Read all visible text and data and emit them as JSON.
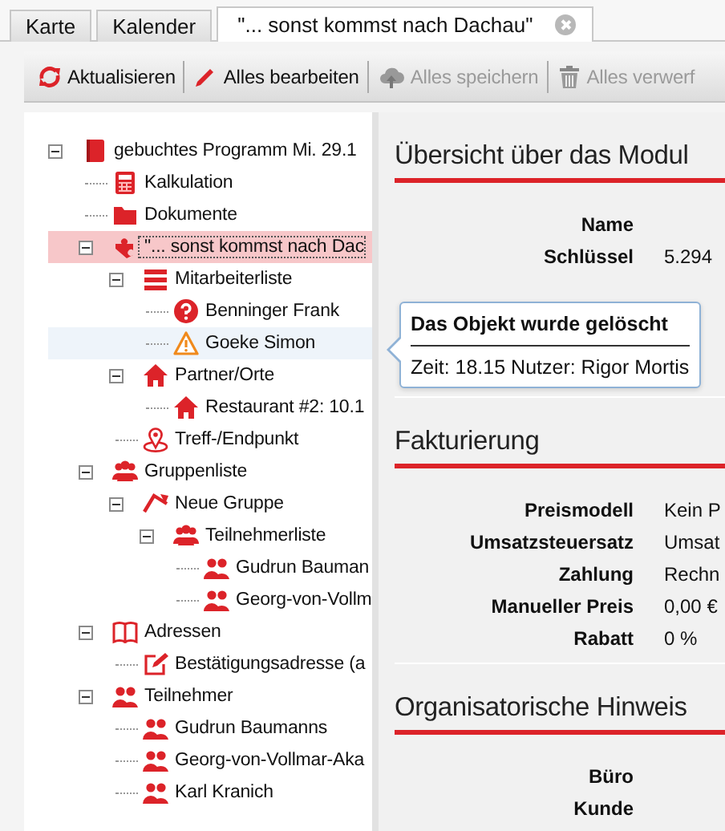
{
  "tabs": [
    {
      "label": "Karte",
      "selected": false,
      "closable": false
    },
    {
      "label": "Kalender",
      "selected": false,
      "closable": false
    },
    {
      "label": "\"... sonst kommst nach Dachau\"",
      "selected": true,
      "closable": true
    }
  ],
  "toolbar": [
    {
      "label": "Aktualisieren",
      "kind": "refresh",
      "disabled": false
    },
    {
      "label": "Alles bearbeiten",
      "kind": "pencil",
      "disabled": false
    },
    {
      "label": "Alles speichern",
      "kind": "cloud",
      "disabled": true
    },
    {
      "label": "Alles verwerf",
      "kind": "trash",
      "disabled": true
    }
  ],
  "tree": [
    {
      "label": "gebuchtes Programm Mi. 29.1",
      "kind": "book",
      "expanded": true,
      "selected": false,
      "hovered": false,
      "children": [
        {
          "label": "Kalkulation",
          "kind": "calculator",
          "selected": false,
          "hovered": false
        },
        {
          "label": "Dokumente",
          "kind": "folder",
          "selected": false,
          "hovered": false
        },
        {
          "label": "\"... sonst kommst nach Dac",
          "kind": "puzzle",
          "expanded": true,
          "selected": true,
          "hovered": false,
          "children": [
            {
              "label": "Mitarbeiterliste",
              "kind": "list",
              "expanded": true,
              "selected": false,
              "hovered": false,
              "children": [
                {
                  "label": "Benninger Frank",
                  "kind": "question",
                  "selected": false,
                  "hovered": false
                },
                {
                  "label": "Goeke Simon",
                  "kind": "warning",
                  "selected": false,
                  "hovered": true
                }
              ]
            },
            {
              "label": "Partner/Orte",
              "kind": "house",
              "expanded": true,
              "selected": false,
              "hovered": false,
              "children": [
                {
                  "label": "Restaurant #2: 10.1",
                  "kind": "house",
                  "selected": false,
                  "hovered": false
                }
              ]
            },
            {
              "label": "Treff-/Endpunkt",
              "kind": "pin",
              "selected": false,
              "hovered": false
            }
          ]
        },
        {
          "label": "Gruppenliste",
          "kind": "group",
          "expanded": true,
          "selected": false,
          "hovered": false,
          "children": [
            {
              "label": "Neue Gruppe",
              "kind": "roof",
              "expanded": true,
              "selected": false,
              "hovered": false,
              "children": [
                {
                  "label": "Teilnehmerliste",
                  "kind": "group",
                  "expanded": true,
                  "selected": false,
                  "hovered": false,
                  "children": [
                    {
                      "label": "Gudrun Bauman",
                      "kind": "pair",
                      "selected": false,
                      "hovered": false
                    },
                    {
                      "label": "Georg-von-Vollm",
                      "kind": "pair",
                      "selected": false,
                      "hovered": false
                    }
                  ]
                }
              ]
            }
          ]
        },
        {
          "label": "Adressen",
          "kind": "openbook",
          "expanded": true,
          "selected": false,
          "hovered": false,
          "children": [
            {
              "label": "Bestätigungsadresse (a",
              "kind": "edit",
              "selected": false,
              "hovered": false
            }
          ]
        },
        {
          "label": "Teilnehmer",
          "kind": "pair",
          "expanded": true,
          "selected": false,
          "hovered": false,
          "children": [
            {
              "label": "Gudrun Baumanns",
              "kind": "pair",
              "selected": false,
              "hovered": false
            },
            {
              "label": "Georg-von-Vollmar-Aka",
              "kind": "pair",
              "selected": false,
              "hovered": false
            },
            {
              "label": "Karl Kranich",
              "kind": "pair",
              "selected": false,
              "hovered": false
            }
          ]
        }
      ]
    }
  ],
  "sections": [
    {
      "title": "Übersicht über das Modul",
      "rows": [
        {
          "label": "Name"
        },
        {
          "label": "Schlüssel",
          "value": "5.294"
        }
      ]
    },
    {
      "title": "Fakturierung",
      "rows": [
        {
          "label": "Preismodell",
          "value": "Kein P"
        },
        {
          "label": "Umsatzsteuersatz",
          "value": "Umsat"
        },
        {
          "label": "Zahlung",
          "value": "Rechn"
        },
        {
          "label": "Manueller Preis",
          "value": "0,00 €"
        },
        {
          "label": "Rabatt",
          "value": "0 %"
        }
      ]
    },
    {
      "title": "Organisatorische Hinweis",
      "rows": [
        {
          "label": "Büro"
        },
        {
          "label": "Kunde"
        }
      ]
    }
  ],
  "tooltip": {
    "title": "Das Objekt wurde gelöscht",
    "text": "Zeit: 18.15 Nutzer: Rigor Mortis"
  }
}
